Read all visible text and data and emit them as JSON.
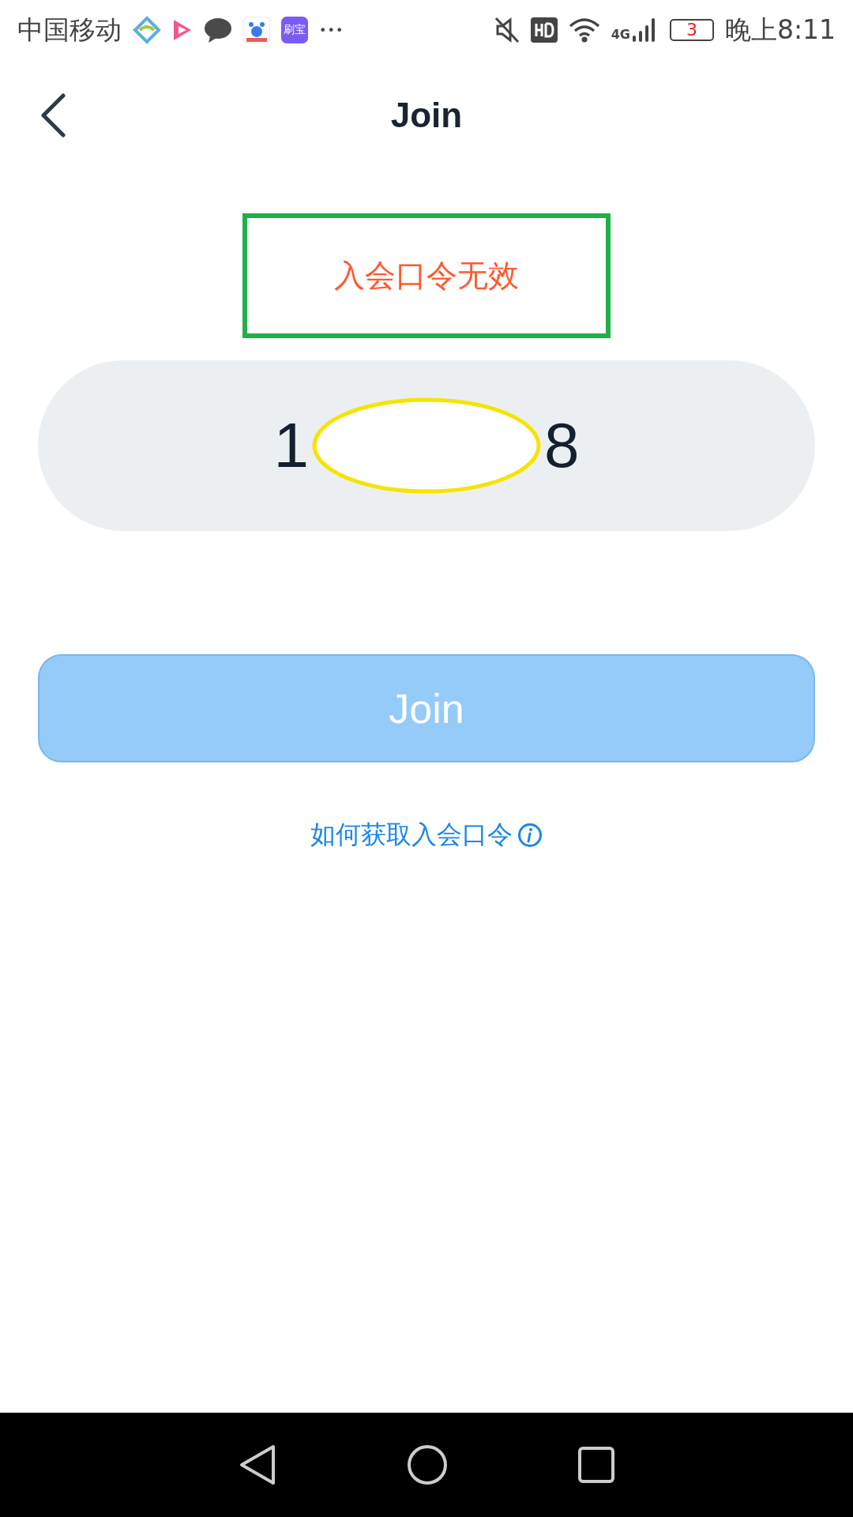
{
  "status_bar": {
    "carrier": "中国移动",
    "more": "•••",
    "app_badge": "刷宝",
    "network": "4G",
    "battery": "3",
    "time": "晚上8:11"
  },
  "header": {
    "title": "Join"
  },
  "error": {
    "message": "入会口令无效",
    "highlighted": true
  },
  "code_field": {
    "value_parts": [
      "1",
      "8"
    ],
    "redacted": true
  },
  "join_button": {
    "label": "Join",
    "disabled": true
  },
  "help_link": {
    "label": "如何获取入会口令"
  }
}
